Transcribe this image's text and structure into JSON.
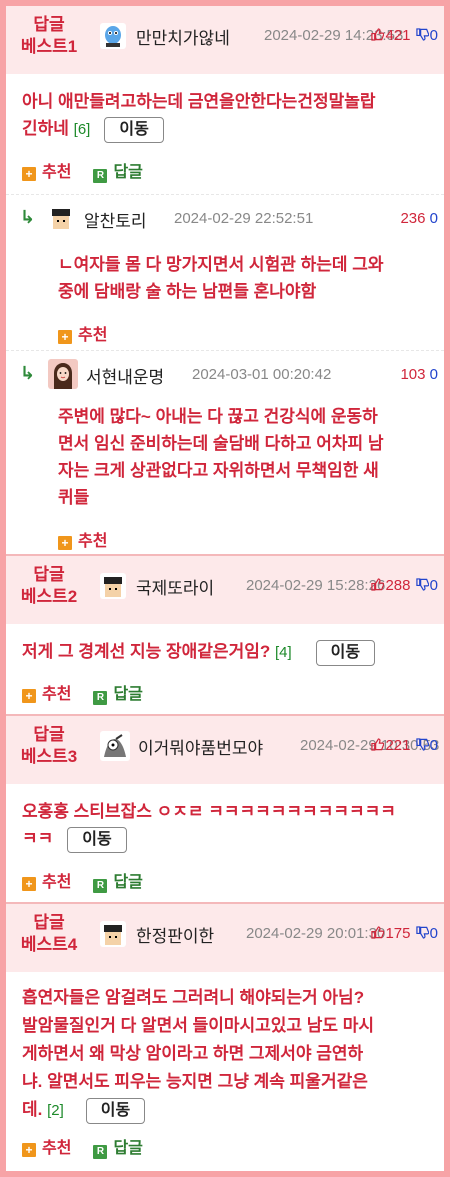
{
  "common": {
    "recommend": "추천",
    "reply": "답글",
    "move": "이동"
  },
  "best1": {
    "tag_line1": "답글",
    "tag_line2": "베스트1",
    "nick": "만만치가않네",
    "date": "2024-02-29 14:23:53",
    "up": "421",
    "down": "0",
    "content_1": "아니 애만들려고하는데 금연을안한다는건정말놀랍",
    "content_2": "긴하네",
    "count": "[6]",
    "replies": [
      {
        "nick": "알찬토리",
        "date": "2024-02-29 22:52:51",
        "up": "236",
        "down": "0",
        "lines": [
          "ㄴ여자들 몸 다 망가지면서 시험관 하는데 그와",
          "중에 담배랑 술 하는 남편들 혼나야함"
        ]
      },
      {
        "nick": "서현내운명",
        "date": "2024-03-01 00:20:42",
        "up": "103",
        "down": "0",
        "lines": [
          "주변에 많다~ 아내는 다 끊고 건강식에 운동하",
          "면서 임신 준비하는데 술담배 다하고 어차피 남",
          "자는 크게 상관없다고 자위하면서 무책임한 새",
          "퀴들"
        ]
      }
    ]
  },
  "best2": {
    "tag_line1": "답글",
    "tag_line2": "베스트2",
    "nick": "국제또라이",
    "date": "2024-02-29 15:28:26",
    "up": "288",
    "down": "0",
    "content": "저게 그 경계선 지능 장애같은거임?",
    "count": "[4]"
  },
  "best3": {
    "tag_line1": "답글",
    "tag_line2": "베스트3",
    "nick": "이거뭐야품번모야",
    "date": "2024-02-29 10:30:53",
    "up": "221",
    "down": "0",
    "content_1": "오홍홍 스티브잡스 ㅇㅈㄹ ㅋㅋㅋㅋㅋㅋㅋㅋㅋㅋㅋㅋ",
    "content_2": "ㅋㅋ"
  },
  "best4": {
    "tag_line1": "답글",
    "tag_line2": "베스트4",
    "nick": "한정판이한",
    "date": "2024-02-29 20:01:30",
    "up": "175",
    "down": "0",
    "lines": [
      "흡연자들은 암걸려도 그러려니 해야되는거 아님?",
      "발암물질인거 다 알면서 들이마시고있고 남도 마시",
      "게하면서 왜 막상 암이라고 하면 그제서야 금연하",
      "냐. 알면서도 피우는 능지면 그냥 계속 피울거같은"
    ],
    "last": "데.",
    "count": "[2]"
  }
}
